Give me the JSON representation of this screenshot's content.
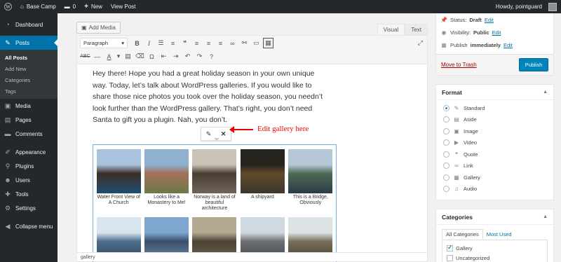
{
  "adminbar": {
    "site_name": "Base Camp",
    "comments": "0",
    "new_label": "New",
    "view_post": "View Post",
    "howdy": "Howdy, pointguard"
  },
  "sidebar": {
    "items_top": [
      {
        "label": "Dashboard",
        "icon": "dashboard-icon",
        "glyph": "◔"
      }
    ],
    "posts": {
      "label": "Posts",
      "icon": "pin-icon",
      "glyph": "✎"
    },
    "posts_sub": [
      "All Posts",
      "Add New",
      "Categories",
      "Tags"
    ],
    "items": [
      {
        "label": "Media",
        "icon": "media-icon",
        "glyph": "▣"
      },
      {
        "label": "Pages",
        "icon": "pages-icon",
        "glyph": "▤"
      },
      {
        "label": "Comments",
        "icon": "comments-icon",
        "glyph": "▬"
      },
      {
        "label": "Appearance",
        "icon": "brush-icon",
        "glyph": "✐"
      },
      {
        "label": "Plugins",
        "icon": "plug-icon",
        "glyph": "⚲"
      },
      {
        "label": "Users",
        "icon": "users-icon",
        "glyph": "☻"
      },
      {
        "label": "Tools",
        "icon": "wrench-icon",
        "glyph": "✚"
      },
      {
        "label": "Settings",
        "icon": "settings-icon",
        "glyph": "⚙"
      },
      {
        "label": "Collapse menu",
        "icon": "collapse-icon",
        "glyph": "◀"
      }
    ]
  },
  "editor": {
    "add_media": "Add Media",
    "tab_visual": "Visual",
    "tab_text": "Text",
    "format_select": "Paragraph",
    "paragraph": "Hey there! Hope you had a great holiday season in your own unique way. Today, let’s talk about WordPress galleries. If you would like to share those nice photos you took over the holiday season, you needn’t look further than the WordPress gallery. That’s right, you don’t need Santa to gift you a plugin. Nah, you don’t.",
    "annotation": "Edit gallery here",
    "status_path": "gallery",
    "gallery": [
      {
        "caption": "Water Front View of A Church",
        "colors": [
          "#a9c3dc",
          "#3b2e25",
          "#1e4f72"
        ]
      },
      {
        "caption": "Looks like a Monastery to Me!",
        "colors": [
          "#8fb0cf",
          "#a4705a",
          "#6b7a45"
        ]
      },
      {
        "caption": "Norway is a land of beautiful architecture",
        "colors": [
          "#c9c3b5",
          "#4a3d33",
          "#6e655a"
        ]
      },
      {
        "caption": "A shipyard",
        "colors": [
          "#26241f",
          "#5f4a2a",
          "#3d372e"
        ]
      },
      {
        "caption": "This is a Bridge, Obviously",
        "colors": [
          "#b5c7d6",
          "#4c6a56",
          "#2c3b45"
        ]
      },
      {
        "caption": "",
        "colors": [
          "#d9e4ef",
          "#4d6d8e",
          "#2f4458"
        ]
      },
      {
        "caption": "",
        "colors": [
          "#7fa6cf",
          "#3a4e6a",
          "#6c8fb1"
        ]
      },
      {
        "caption": "",
        "colors": [
          "#b3a890",
          "#4b4235",
          "#6d624f"
        ]
      },
      {
        "caption": "",
        "colors": [
          "#cfd9e2",
          "#6e6e6e",
          "#3e4a55"
        ]
      },
      {
        "caption": "",
        "colors": [
          "#dce3e5",
          "#7a6e5c",
          "#46402f"
        ]
      }
    ]
  },
  "publish": {
    "status_label": "Status:",
    "status_value": "Draft",
    "edit": "Edit",
    "visibility_label": "Visibility:",
    "visibility_value": "Public",
    "publish_label": "Publish",
    "publish_value": "immediately",
    "trash": "Move to Trash",
    "publish_button": "Publish"
  },
  "format_box": {
    "title": "Format",
    "options": [
      {
        "label": "Standard",
        "checked": true,
        "glyph": "✎"
      },
      {
        "label": "Aside",
        "checked": false,
        "glyph": "▤"
      },
      {
        "label": "Image",
        "checked": false,
        "glyph": "▣"
      },
      {
        "label": "Video",
        "checked": false,
        "glyph": "▶"
      },
      {
        "label": "Quote",
        "checked": false,
        "glyph": "❝"
      },
      {
        "label": "Link",
        "checked": false,
        "glyph": "∞"
      },
      {
        "label": "Gallery",
        "checked": false,
        "glyph": "▦"
      },
      {
        "label": "Audio",
        "checked": false,
        "glyph": "♫"
      }
    ]
  },
  "categories_box": {
    "title": "Categories",
    "tab_all": "All Categories",
    "tab_most": "Most Used",
    "items": [
      {
        "label": "Gallery",
        "checked": true
      },
      {
        "label": "Uncategorized",
        "checked": false
      }
    ]
  }
}
